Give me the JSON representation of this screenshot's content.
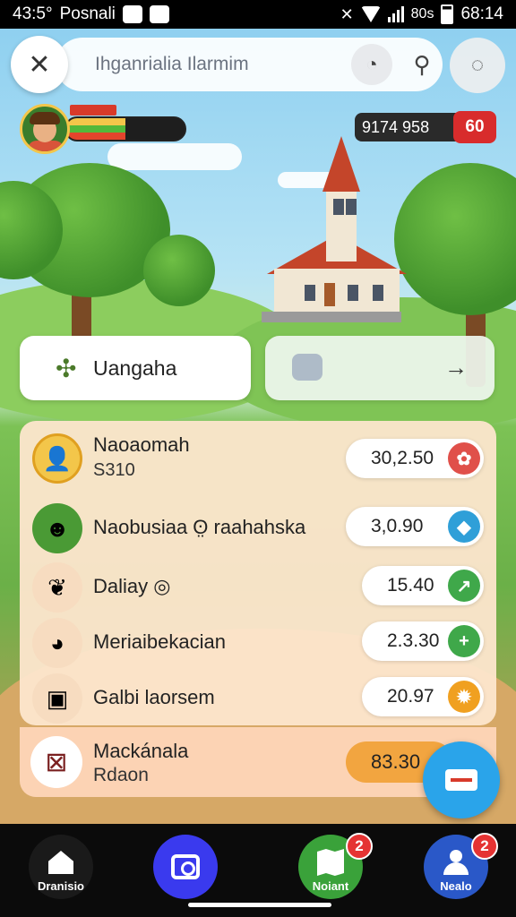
{
  "status_bar": {
    "time_left": "43:5°",
    "carrier": "Posnali",
    "network": "80s",
    "time_right": "68:14"
  },
  "search": {
    "placeholder": "Ihganrialia Ilarmim",
    "menu_icon": "close-x-icon",
    "voice_icon": "voice-search-icon",
    "search_icon": "search-icon",
    "extra_icon": "bell-icon"
  },
  "hud": {
    "currency_value": "9174 958",
    "currency_badge": "60",
    "health_fraction": 0.5
  },
  "quest": {
    "label": "Uangaha"
  },
  "items": [
    {
      "name": "Naoaomah",
      "sub": "S310",
      "value": "30,2.50",
      "icon": "farmer-avatar-icon",
      "action_icon": "flower-icon",
      "action_color": "#e0504a"
    },
    {
      "name": "Naobusiaa ʘ̤ raahahska",
      "sub": "",
      "value": "3,0.90",
      "icon": "character-icon",
      "action_icon": "tag-icon",
      "action_color": "#2f9fd8"
    },
    {
      "name": "Daliay ◎",
      "sub": "",
      "value": "15.40",
      "icon": "plant-icon",
      "action_icon": "arrow-up-right-icon",
      "action_color": "#3fa84a"
    },
    {
      "name": "Meriaibekacian",
      "sub": "",
      "value": "2.3.30",
      "icon": "food-icon",
      "action_icon": "plus-icon",
      "action_color": "#3fa84a"
    },
    {
      "name": "Galbi laorsem",
      "sub": "",
      "value": "20.97",
      "icon": "bread-icon",
      "action_icon": "sun-icon",
      "action_color": "#f0a020"
    }
  ],
  "bottom_card": {
    "title": "Mackánala",
    "subtitle": "Rdaon",
    "value": "83.30"
  },
  "nav": [
    {
      "label": "Dranisio",
      "icon": "home-icon",
      "color": "#1a1a1a",
      "badge": ""
    },
    {
      "label": "",
      "icon": "shopping-bag-icon",
      "color": "#3a3aee",
      "badge": ""
    },
    {
      "label": "Noiant",
      "icon": "map-icon",
      "color": "#3aa23a",
      "badge": "2"
    },
    {
      "label": "Nealo",
      "icon": "user-icon",
      "color": "#2a58c8",
      "badge": "2"
    }
  ]
}
